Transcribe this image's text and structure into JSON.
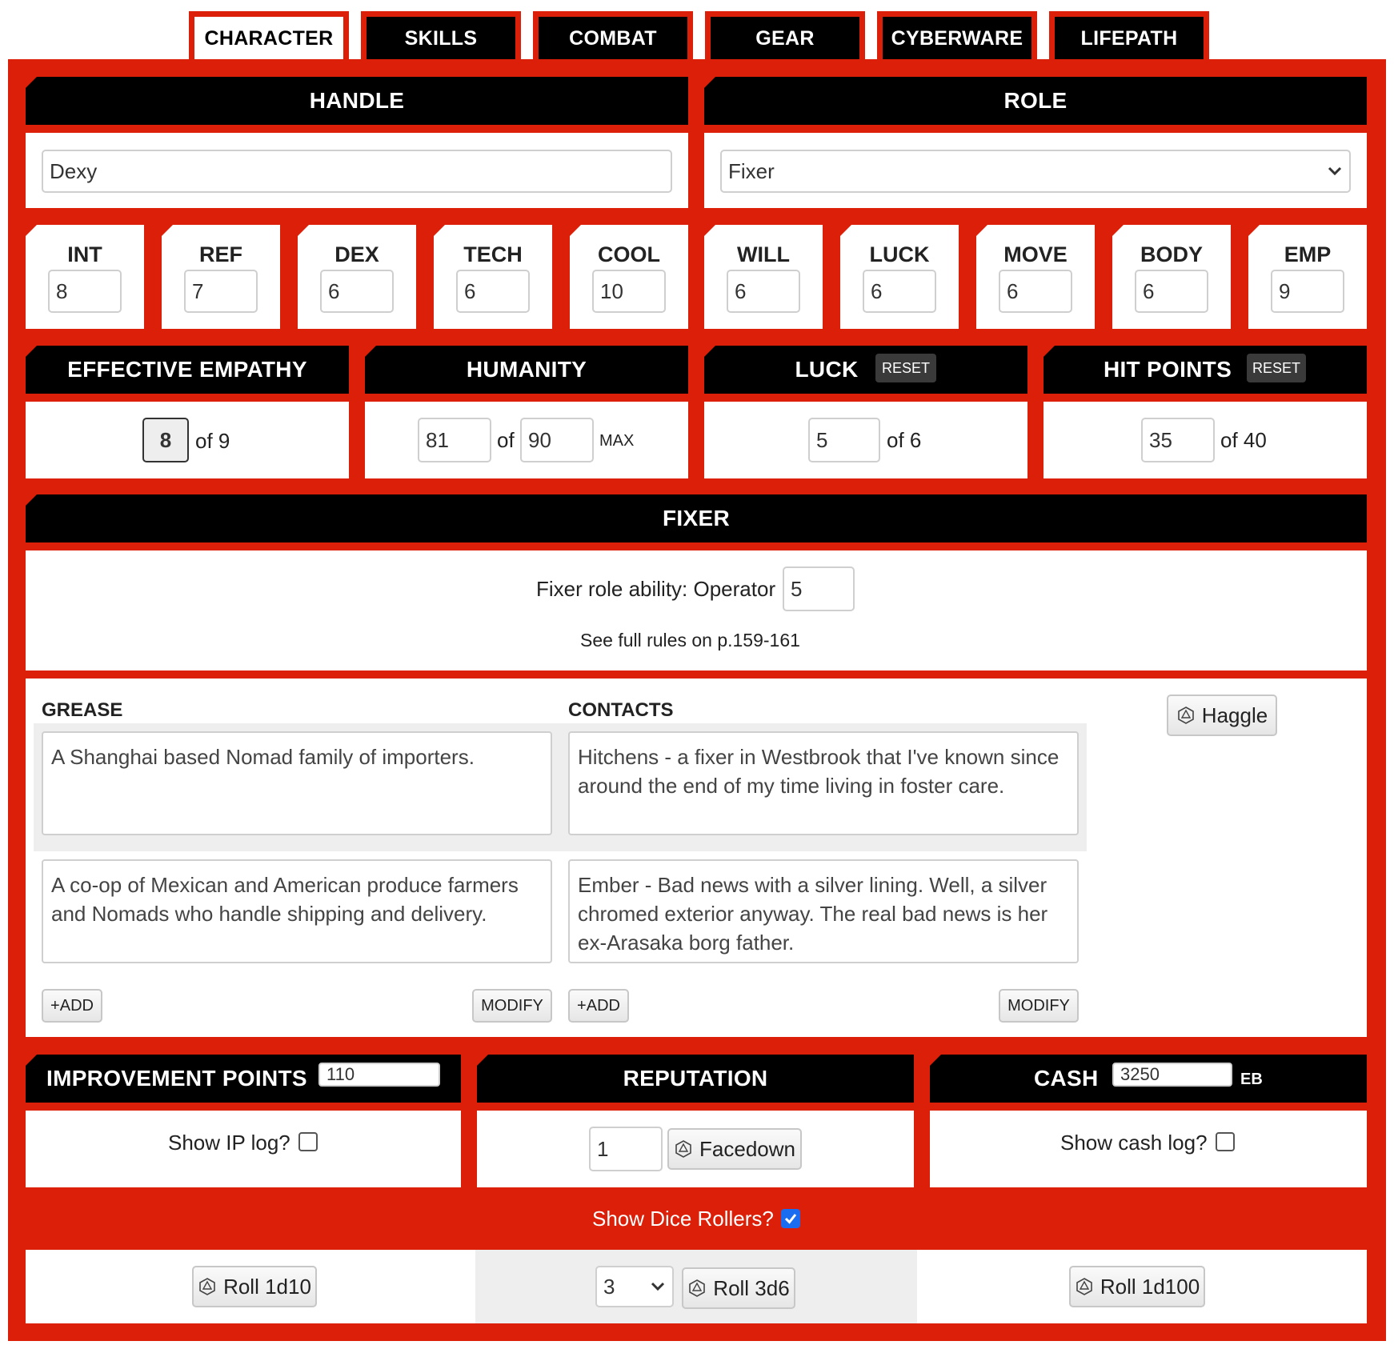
{
  "tabs": [
    {
      "label": "CHARACTER",
      "active": true
    },
    {
      "label": "SKILLS",
      "active": false
    },
    {
      "label": "COMBAT",
      "active": false
    },
    {
      "label": "GEAR",
      "active": false
    },
    {
      "label": "CYBERWARE",
      "active": false
    },
    {
      "label": "LIFEPATH",
      "active": false
    }
  ],
  "handle": {
    "header": "HANDLE",
    "value": "Dexy"
  },
  "role": {
    "header": "ROLE",
    "value": "Fixer"
  },
  "stats": [
    {
      "label": "INT",
      "value": "8"
    },
    {
      "label": "REF",
      "value": "7"
    },
    {
      "label": "DEX",
      "value": "6"
    },
    {
      "label": "TECH",
      "value": "6"
    },
    {
      "label": "COOL",
      "value": "10"
    },
    {
      "label": "WILL",
      "value": "6"
    },
    {
      "label": "LUCK",
      "value": "6"
    },
    {
      "label": "MOVE",
      "value": "6"
    },
    {
      "label": "BODY",
      "value": "6"
    },
    {
      "label": "EMP",
      "value": "9"
    }
  ],
  "effective_empathy": {
    "header": "EFFECTIVE EMPATHY",
    "value": "8",
    "of_text": "of 9"
  },
  "humanity": {
    "header": "HUMANITY",
    "current": "81",
    "of_text": "of",
    "max": "90",
    "max_label": "MAX"
  },
  "luck": {
    "header": "LUCK",
    "reset_label": "RESET",
    "current": "5",
    "of_text": "of 6"
  },
  "hit_points": {
    "header": "HIT POINTS",
    "reset_label": "RESET",
    "current": "35",
    "of_text": "of 40"
  },
  "fixer": {
    "header": "FIXER",
    "ability_label": "Fixer role ability: Operator",
    "ability_value": "5",
    "rules_text": "See full rules on p.159-161"
  },
  "grease": {
    "header": "GREASE",
    "entries": [
      "A Shanghai based Nomad family of importers.",
      "A co-op of Mexican and American produce farmers and Nomads who handle shipping and delivery."
    ],
    "add_label": "+ADD",
    "modify_label": "MODIFY"
  },
  "contacts": {
    "header": "CONTACTS",
    "entries": [
      "Hitchens - a fixer in Westbrook that I've known since around the end of my time living in foster care.",
      "Ember - Bad news with a silver lining. Well, a silver chromed exterior anyway. The real bad news is her ex-Arasaka borg father."
    ],
    "add_label": "+ADD",
    "modify_label": "MODIFY"
  },
  "haggle_label": "Haggle",
  "improvement_points": {
    "header": "IMPROVEMENT POINTS",
    "value": "110",
    "log_label": "Show IP log?"
  },
  "reputation": {
    "header": "REPUTATION",
    "value": "1",
    "button_label": "Facedown"
  },
  "cash": {
    "header": "CASH",
    "value": "3250",
    "unit": "EB",
    "log_label": "Show cash log?"
  },
  "dice": {
    "toggle_label": "Show Dice Rollers?",
    "roll_1d10": "Roll 1d10",
    "count_value": "3",
    "roll_3d6": "Roll 3d6",
    "roll_1d100": "Roll 1d100"
  },
  "colors": {
    "frame": "#dc1f08",
    "bar": "#000000",
    "checkbox": "#1a6cf0"
  },
  "icons": {
    "dice": "d20-die-icon",
    "dropdown": "chevron-down-icon"
  }
}
